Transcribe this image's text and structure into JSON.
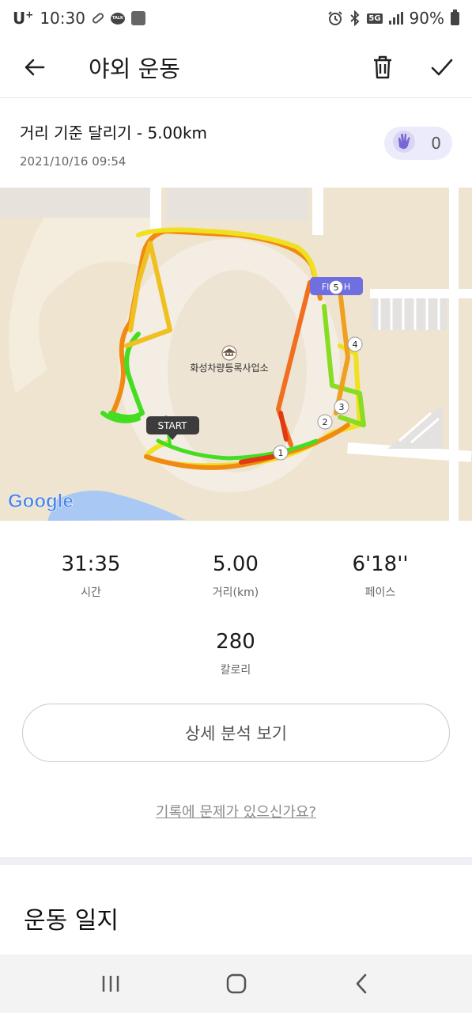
{
  "status": {
    "carrier": "U",
    "carrier_plus": "+",
    "time": "10:30",
    "network": "5G",
    "battery": "90%",
    "talk_label": "TALK"
  },
  "app_bar": {
    "title": "야외 운동"
  },
  "workout": {
    "title": "거리 기준 달리기 - 5.00km",
    "date": "2021/10/16 09:54",
    "clap_count": "0"
  },
  "map": {
    "place_label": "화성차량등록사업소",
    "start_label": "START",
    "finish_label": "FINISH",
    "markers": [
      "1",
      "2",
      "3",
      "4",
      "5"
    ],
    "google_label": "Google"
  },
  "stats": {
    "time_value": "31:35",
    "time_label": "시간",
    "distance_value": "5.00",
    "distance_label": "거리(km)",
    "pace_value": "6'18''",
    "pace_label": "페이스",
    "calories_value": "280",
    "calories_label": "칼로리"
  },
  "actions": {
    "analysis_label": "상세 분석 보기",
    "problem_label": "기록에 문제가 있으신가요?"
  },
  "journal": {
    "title": "운동 일지"
  },
  "colors": {
    "accent": "#6f6fe0",
    "route_green": "#44dd22",
    "route_yellow": "#f0e020",
    "route_orange": "#f08a10",
    "route_red": "#e23a10"
  }
}
